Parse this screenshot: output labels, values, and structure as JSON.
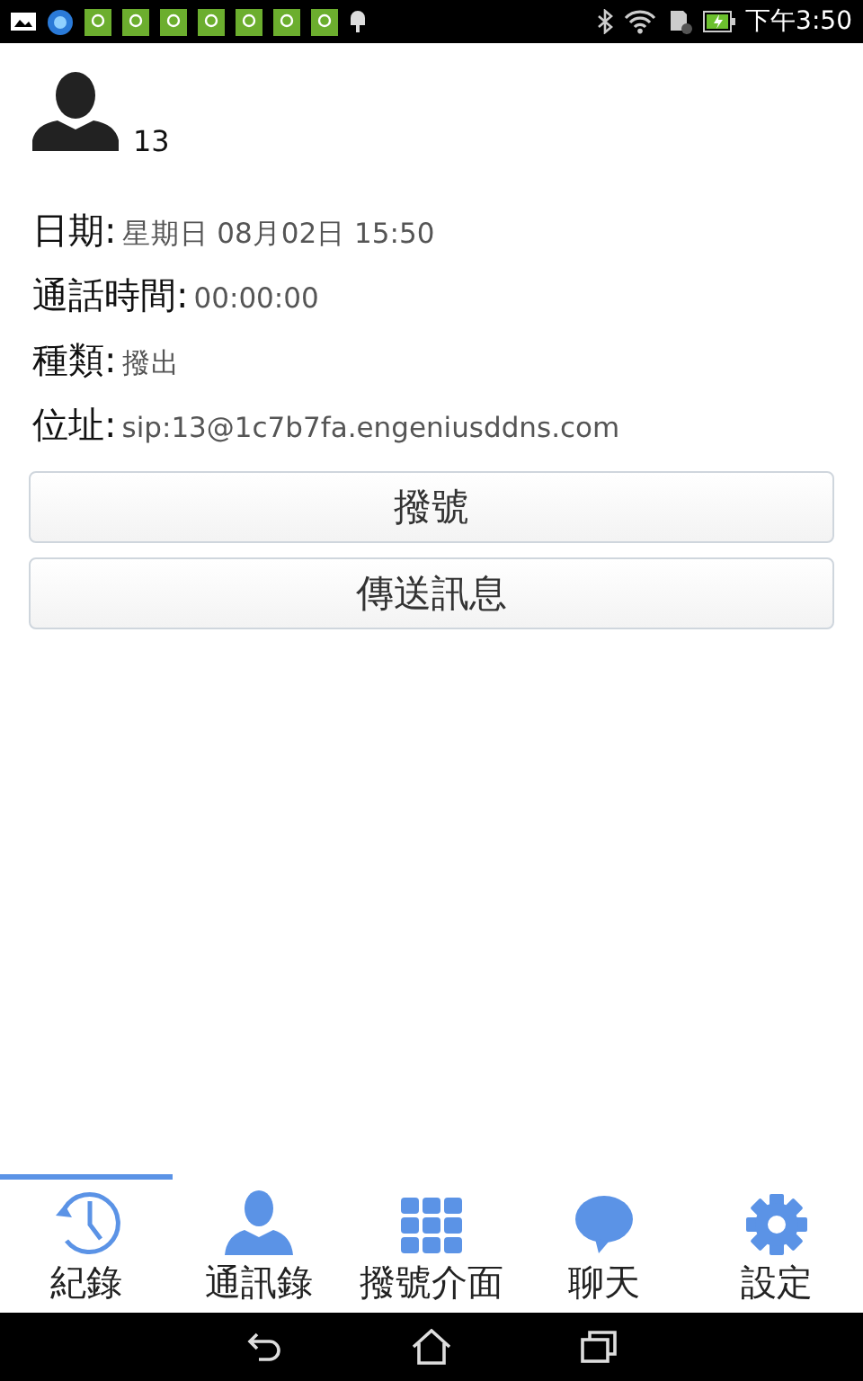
{
  "status_bar": {
    "time": "下午3:50"
  },
  "contact": {
    "name": "13"
  },
  "details": [
    {
      "label": "日期:",
      "value": "星期日 08月02日 15:50"
    },
    {
      "label": "通話時間:",
      "value": "00:00:00"
    },
    {
      "label": "種類:",
      "value": "撥出"
    },
    {
      "label": "位址:",
      "value": "sip:13@1c7b7fa.engeniusddns.com"
    }
  ],
  "buttons": [
    "撥號",
    "傳送訊息"
  ],
  "tabs": [
    {
      "label": "紀錄",
      "kind": "history",
      "selected": true
    },
    {
      "label": "通訊錄",
      "kind": "contacts",
      "selected": false
    },
    {
      "label": "撥號介面",
      "kind": "dialpad",
      "selected": false
    },
    {
      "label": "聊天",
      "kind": "chat",
      "selected": false
    },
    {
      "label": "設定",
      "kind": "settings",
      "selected": false
    }
  ]
}
